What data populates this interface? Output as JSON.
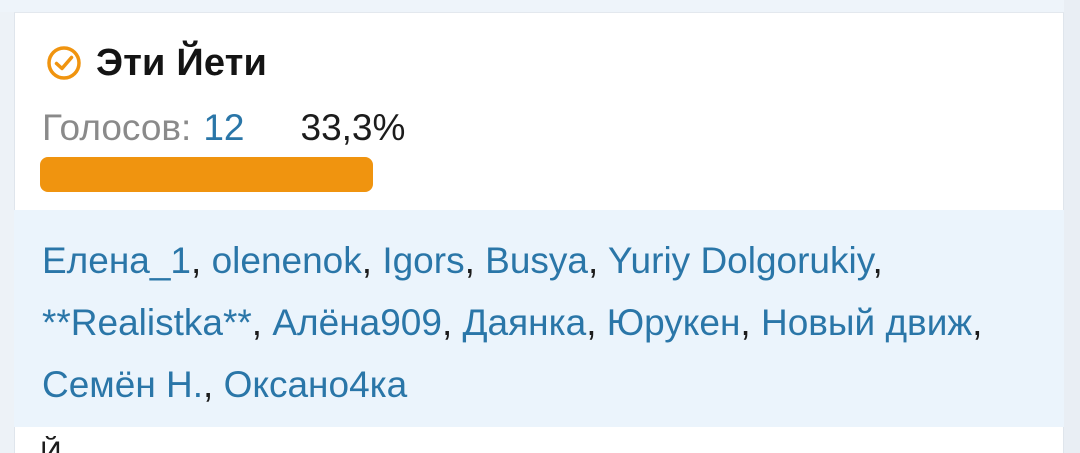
{
  "poll_option": {
    "title": "Эти Йети",
    "selected": true,
    "votes_label": "Голосов:",
    "votes_count": "12",
    "percent_label": "33,3%",
    "percent_value": 33.3,
    "bar_color": "#f0940f",
    "voters": [
      "Елена_1",
      "olenenok",
      "Igors",
      "Busya",
      "Yuriy Dolgorukiy",
      "**Realistka**",
      "Алёна909",
      "Даянка",
      "Юрукен",
      "Новый движ",
      "Семён Н.",
      "Оксано4ка"
    ],
    "separator": ", "
  },
  "next_option_peek": "Й",
  "colors": {
    "accent_check": "#f0940f",
    "link": "#2a76a8",
    "muted": "#8a8a8a",
    "voters_bg": "#ebf4fc"
  }
}
